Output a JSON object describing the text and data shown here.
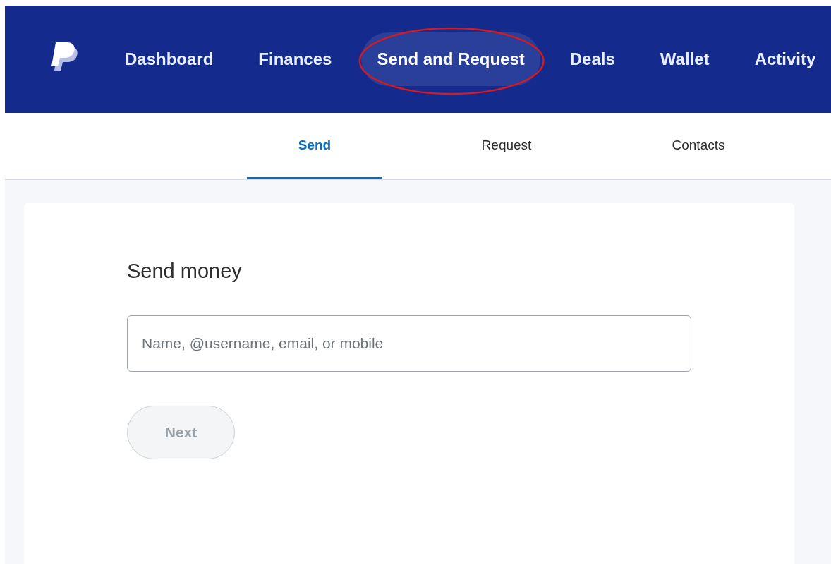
{
  "nav": {
    "items": [
      {
        "label": "Dashboard",
        "selected": false,
        "circled": false
      },
      {
        "label": "Finances",
        "selected": false,
        "circled": false
      },
      {
        "label": "Send and Request",
        "selected": true,
        "circled": true
      },
      {
        "label": "Deals",
        "selected": false,
        "circled": false
      },
      {
        "label": "Wallet",
        "selected": false,
        "circled": false
      },
      {
        "label": "Activity",
        "selected": false,
        "circled": false
      }
    ]
  },
  "subtabs": [
    {
      "label": "Send",
      "selected": true
    },
    {
      "label": "Request",
      "selected": false
    },
    {
      "label": "Contacts",
      "selected": false
    }
  ],
  "form": {
    "title": "Send money",
    "recipient": {
      "placeholder": "Name, @username, email, or mobile"
    },
    "next_button": {
      "label": "Next",
      "disabled": true
    }
  }
}
